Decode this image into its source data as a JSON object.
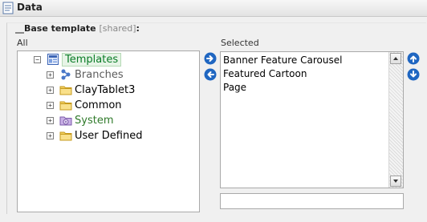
{
  "window": {
    "title": "Data",
    "icon": "document-icon"
  },
  "field": {
    "name": "__Base template",
    "shared_tag": "[shared]",
    "colon": ":"
  },
  "labels": {
    "all": "All",
    "selected": "Selected"
  },
  "tree": {
    "items": [
      {
        "label": "Templates",
        "icon": "templates-icon",
        "expander": "−"
      },
      {
        "label": "Branches",
        "icon": "branches-icon",
        "expander": "+"
      },
      {
        "label": "ClayTablet3",
        "icon": "folder-icon",
        "expander": "+"
      },
      {
        "label": "Common",
        "icon": "folder-icon",
        "expander": "+"
      },
      {
        "label": "System",
        "icon": "system-icon",
        "expander": "+"
      },
      {
        "label": "User Defined",
        "icon": "folder-icon",
        "expander": "+"
      }
    ]
  },
  "selected_list": {
    "items": [
      "Banner Feature Carousel",
      "Featured Cartoon",
      "Page"
    ]
  },
  "filter": {
    "value": ""
  },
  "colors": {
    "accent": "#1f66c1",
    "templates_text": "#0a7c27",
    "system_text": "#2f7a2a",
    "branches_text": "#5c5c5c"
  }
}
